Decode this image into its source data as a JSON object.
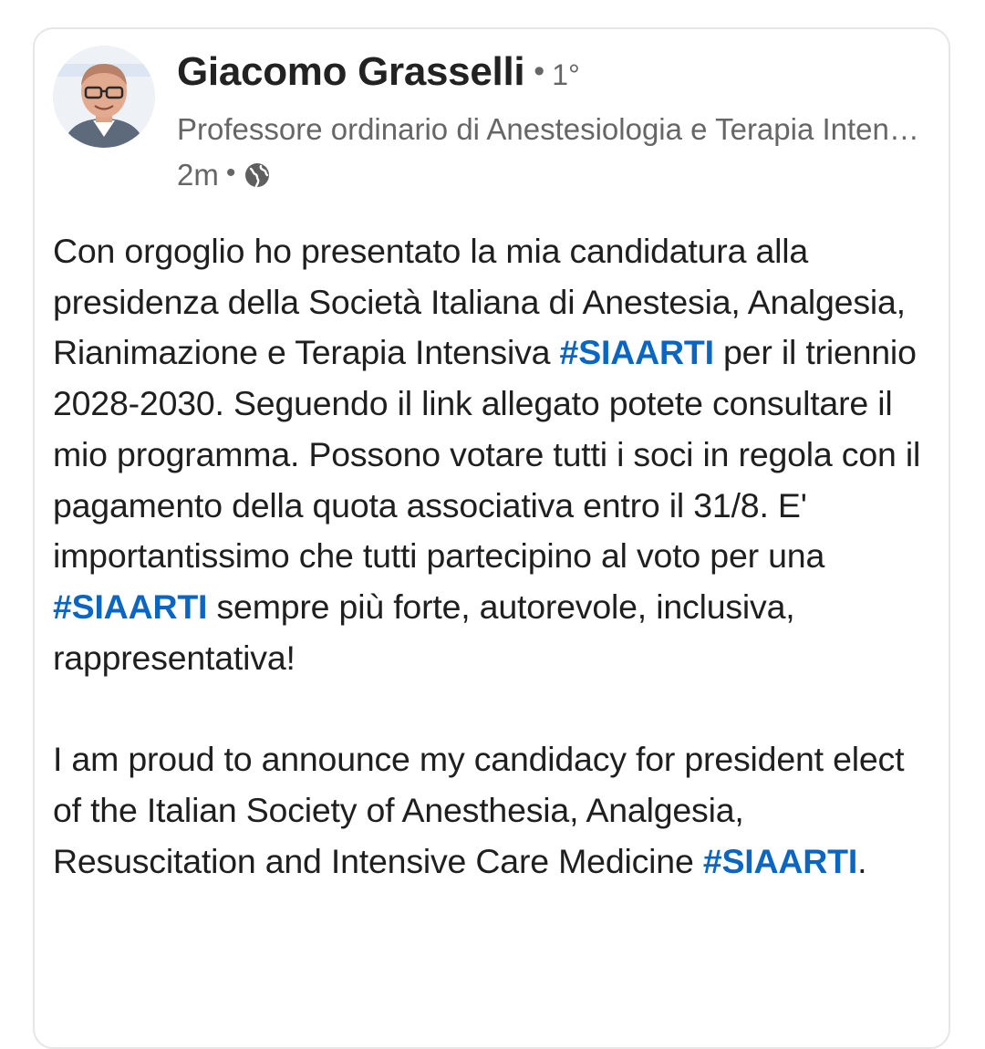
{
  "post": {
    "author": {
      "name": "Giacomo Grasselli",
      "separator": "•",
      "degree": "1°",
      "headline": "Professore ordinario di Anestesiologia e Terapia Intensiva",
      "time": "2m",
      "meta_separator": "•",
      "visibility_icon": "globe-icon"
    },
    "body_it": {
      "seg1": "Con orgoglio ho presentato la mia candidatura alla presidenza della Società Italiana di Anestesia, Analgesia, Rianimazione e Terapia Intensiva ",
      "hashtag1": "#SIAARTI",
      "seg2": " per il triennio 2028-2030. Seguendo il link allegato potete consultare il mio programma. Possono votare tutti i soci in regola con il pagamento della quota associativa entro il 31/8. E' importantissimo che tutti partecipino al voto per una ",
      "hashtag2": "#SIAARTI",
      "seg3": " sempre più forte, autorevole, inclusiva, rappresentativa!"
    },
    "body_en": {
      "seg1": "I am proud to announce my candidacy for president elect of the Italian Society of Anesthesia, Analgesia, Resuscitation and Intensive Care Medicine ",
      "hashtag": "#SIAARTI",
      "seg2": "."
    }
  },
  "colors": {
    "hashtag": "#0a66c2",
    "text": "#1f1f1f",
    "secondary_text": "#666666",
    "card_border": "#e6e6e6"
  }
}
